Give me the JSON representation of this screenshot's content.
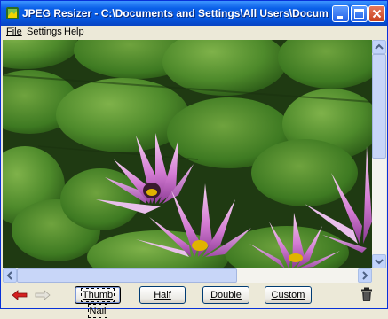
{
  "window": {
    "title": "JPEG Resizer - C:\\Documents and Settings\\All Users\\Documents\\My ..."
  },
  "menu": [
    {
      "label": "File"
    },
    {
      "label": "Settings"
    },
    {
      "label": "Help"
    }
  ],
  "image": {
    "subject": "water-lilies-photo"
  },
  "toolbar": {
    "back_icon": "red-left-arrow-icon",
    "forward_icon": "gray-right-arrow-icon",
    "buttons": [
      {
        "label": "Thumb Nail",
        "focused": true
      },
      {
        "label": "Half"
      },
      {
        "label": "Double"
      },
      {
        "label": "Custom"
      }
    ],
    "delete_icon": "trash-can-icon"
  },
  "colors": {
    "titlebar": "#0558E0",
    "window_bg": "#ECE9D8",
    "close_button": "#C8421F"
  }
}
